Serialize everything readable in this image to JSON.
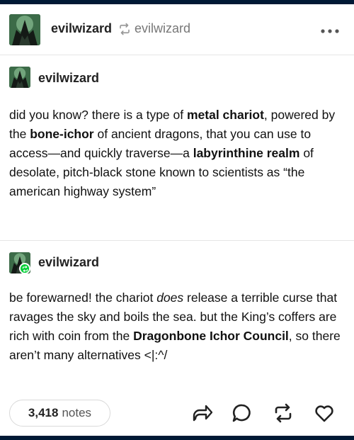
{
  "header": {
    "reblogger": "evilwizard",
    "source": "evilwizard",
    "icons": {
      "reblog": "reblog-icon",
      "more": "more-dots-icon"
    }
  },
  "posts": [
    {
      "author": "evilwizard",
      "segments": [
        {
          "text": "did you know? there is a type of ",
          "style": "normal"
        },
        {
          "text": "metal chariot",
          "style": "bold"
        },
        {
          "text": ", powered by the ",
          "style": "normal"
        },
        {
          "text": "bone-ichor",
          "style": "bold"
        },
        {
          "text": " of ancient dragons, that you can use to access—and quickly traverse—a ",
          "style": "normal"
        },
        {
          "text": "labyrinthine realm",
          "style": "bold"
        },
        {
          "text": " of desolate, pitch-black stone known to scientists as “the american highway system”",
          "style": "normal"
        }
      ]
    },
    {
      "author": "evilwizard",
      "reblogged": true,
      "segments": [
        {
          "text": "be forewarned! the chariot ",
          "style": "normal"
        },
        {
          "text": "does",
          "style": "italic"
        },
        {
          "text": " release a terrible curse that ravages the sky and boils the sea. but the King’s coffers are rich with coin from the ",
          "style": "normal"
        },
        {
          "text": "Dragonbone Ichor Council",
          "style": "bold"
        },
        {
          "text": ", so there aren’t many alternatives <|:^/",
          "style": "normal"
        }
      ]
    }
  ],
  "footer": {
    "notes_count": "3,418",
    "notes_label": "notes",
    "actions": [
      "share-icon",
      "reply-icon",
      "reblog-icon",
      "like-heart-icon"
    ]
  },
  "colors": {
    "background": "#001935",
    "card": "#ffffff",
    "reblog_green": "#00cf35"
  }
}
